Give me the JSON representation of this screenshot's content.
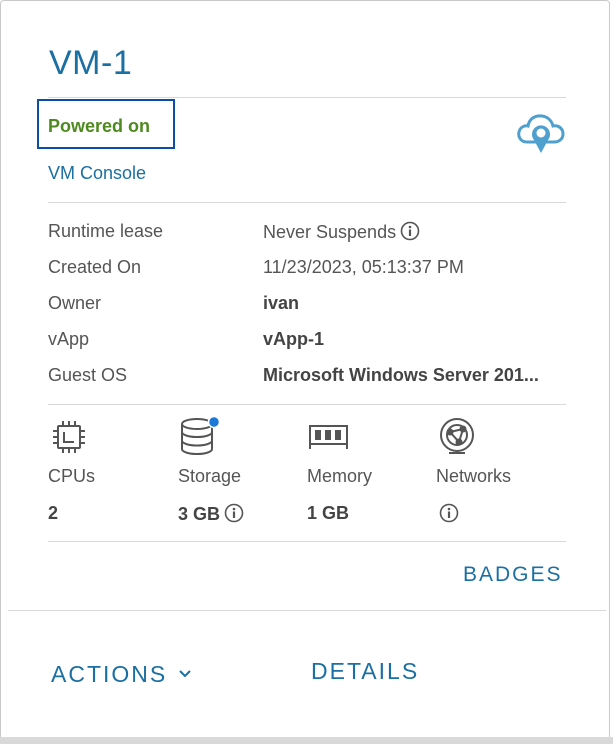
{
  "vm": {
    "name": "VM-1",
    "status": "Powered on",
    "console_link": "VM Console"
  },
  "properties": [
    {
      "label": "Runtime lease",
      "value": "Never Suspends"
    },
    {
      "label": "Created On",
      "value": "11/23/2023, 05:13:37 PM"
    },
    {
      "label": "Owner",
      "value": "ivan"
    },
    {
      "label": "vApp",
      "value": "vApp-1"
    },
    {
      "label": "Guest OS",
      "value": "Microsoft Windows Server 201..."
    }
  ],
  "resources": [
    {
      "label": "CPUs",
      "value": "2",
      "icon": "cpu-icon"
    },
    {
      "label": "Storage",
      "value": "3 GB",
      "icon": "storage-icon"
    },
    {
      "label": "Memory",
      "value": "1 GB",
      "icon": "memory-icon"
    },
    {
      "label": "Networks",
      "value": "",
      "icon": "network-icon"
    }
  ],
  "links": {
    "badges": "BADGES",
    "actions": "ACTIONS",
    "details": "DETAILS"
  },
  "colors": {
    "accent": "#1a6fa3",
    "status_on": "#4e8a1f",
    "focus": "#0a4ea8",
    "badge_dot": "#1b78d4"
  }
}
